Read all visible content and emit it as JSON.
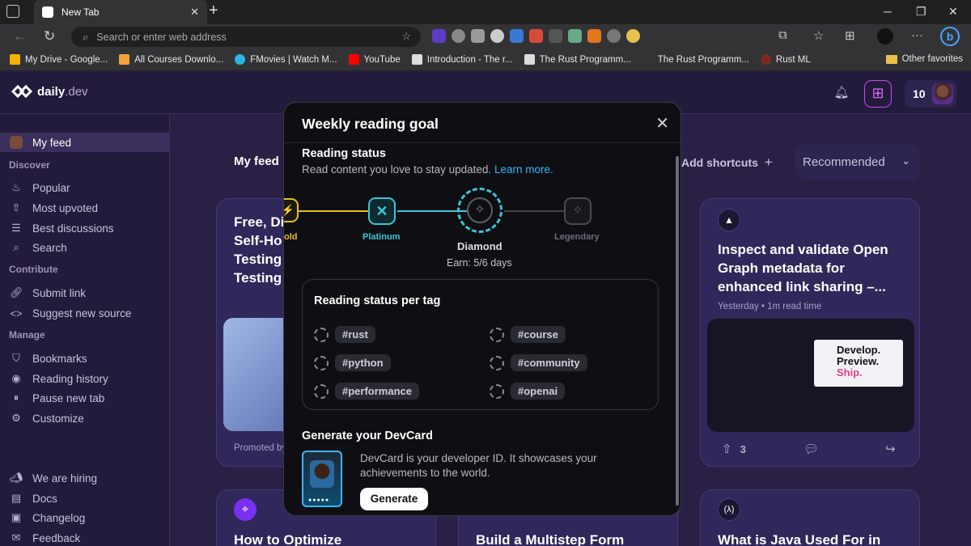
{
  "browser": {
    "tab_title": "New Tab",
    "address_placeholder": "Search or enter web address",
    "bookmarks": [
      {
        "label": "My Drive - Google...",
        "color": "#f4b400"
      },
      {
        "label": "All Courses Downlo...",
        "color": "#f2a33a"
      },
      {
        "label": "FMovies | Watch M...",
        "color": "#2bb5e8"
      },
      {
        "label": "YouTube",
        "color": "#ff0000"
      },
      {
        "label": "Introduction - The r...",
        "color": "#dddddd"
      },
      {
        "label": "The Rust Programm...",
        "color": "#dddddd"
      },
      {
        "label": "The Rust Programm...",
        "color": "#333333"
      },
      {
        "label": "Rust ML",
        "color": "#7a2a1a"
      }
    ],
    "other_favorites": "Other favorites"
  },
  "header": {
    "logo_text": "daily",
    "logo_suffix": ".dev",
    "reputation": "10"
  },
  "sidebar": {
    "my_feed": "My feed",
    "sections": {
      "discover": "Discover",
      "contribute": "Contribute",
      "manage": "Manage"
    },
    "discover_items": [
      "Popular",
      "Most upvoted",
      "Best discussions",
      "Search"
    ],
    "contribute_items": [
      "Submit link",
      "Suggest new source"
    ],
    "manage_items": [
      "Bookmarks",
      "Reading history",
      "Pause new tab",
      "Customize"
    ],
    "footer_items": [
      "We are hiring",
      "Docs",
      "Changelog",
      "Feedback"
    ]
  },
  "feed": {
    "title": "My feed",
    "add_shortcuts": "Add shortcuts",
    "sort_selected": "Recommended",
    "cards": [
      {
        "title_lines": [
          "Free, Di",
          "Self-Ho",
          "Testing",
          "Testing"
        ],
        "promoted": "Promoted by"
      },
      {
        "title": "Inspect and validate Open Graph metadata for enhanced link sharing –...",
        "meta": "Yesterday • 1m read time",
        "upvotes": "3",
        "img_text": [
          "Develop.",
          "Preview.",
          "Ship."
        ]
      },
      {
        "title": "How to Optimize"
      },
      {
        "title": "Build a Multistep Form"
      },
      {
        "title": "What is Java Used For in"
      }
    ]
  },
  "modal": {
    "title": "Weekly reading goal",
    "reading_status_title": "Reading status",
    "reading_status_sub": "Read content you love to stay updated.",
    "learn_more": "Learn more.",
    "levels": {
      "gold": "old",
      "platinum": "Platinum",
      "diamond": "Diamond",
      "legendary": "Legendary"
    },
    "earn": "Earn: 5/6 days",
    "tags_title": "Reading status per tag",
    "tags_left": [
      "#rust",
      "#python",
      "#performance"
    ],
    "tags_right": [
      "#course",
      "#community",
      "#openai"
    ],
    "devcard_title": "Generate your DevCard",
    "devcard_desc": "DevCard is your developer ID. It showcases your achievements to the world.",
    "generate": "Generate"
  },
  "colors": {
    "accent_cabbage": "#c44bf2",
    "platinum": "#3cc5d8",
    "gold": "#e5c021",
    "link": "#33b7ff"
  }
}
